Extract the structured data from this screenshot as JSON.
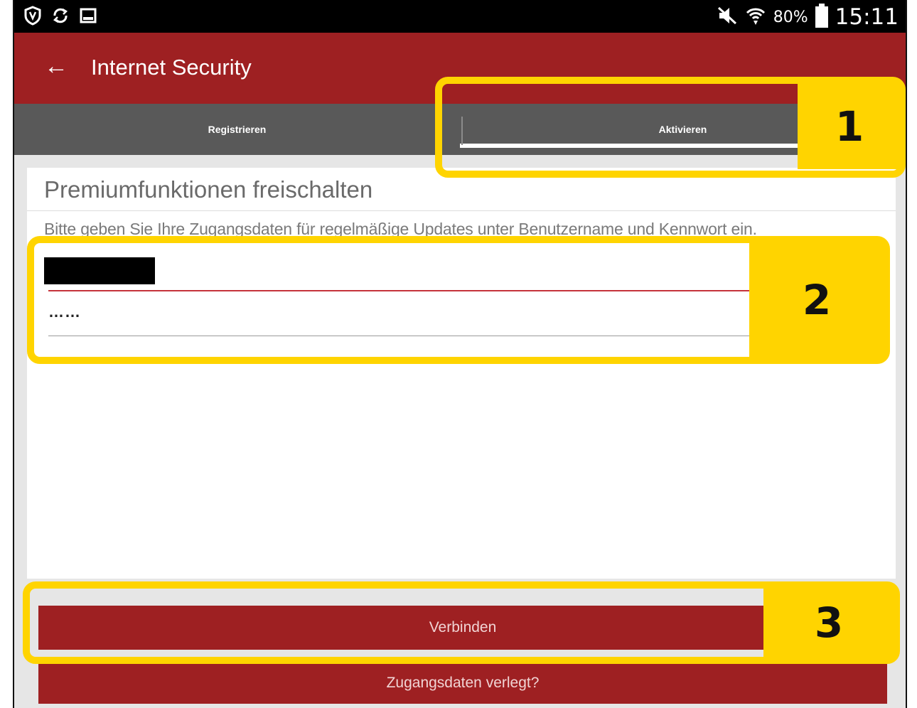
{
  "status_bar": {
    "left_icons": [
      "shield-icon",
      "sync-icon",
      "image-icon"
    ],
    "right_icons": [
      "mute-icon",
      "wifi-icon"
    ],
    "battery": "80%",
    "time": "15:11"
  },
  "appbar": {
    "title": "Internet Security",
    "back_icon": "arrow-left-icon"
  },
  "tabs": [
    {
      "label": "Registrieren",
      "active": false
    },
    {
      "label": "Aktivieren",
      "active": true
    }
  ],
  "card": {
    "title": "Premiumfunktionen freischalten",
    "description": "Bitte geben Sie Ihre Zugangsdaten für regelmäßige Updates unter Benutzername und Kennwort ein."
  },
  "form": {
    "password_value": "……"
  },
  "buttons": {
    "connect": "Verbinden",
    "forgot": "Zugangsdaten verlegt?"
  },
  "callouts": [
    "1",
    "2",
    "3"
  ],
  "colors": {
    "accent": "#9e2022",
    "tab_bar": "#595959",
    "highlight": "#ffd400"
  }
}
